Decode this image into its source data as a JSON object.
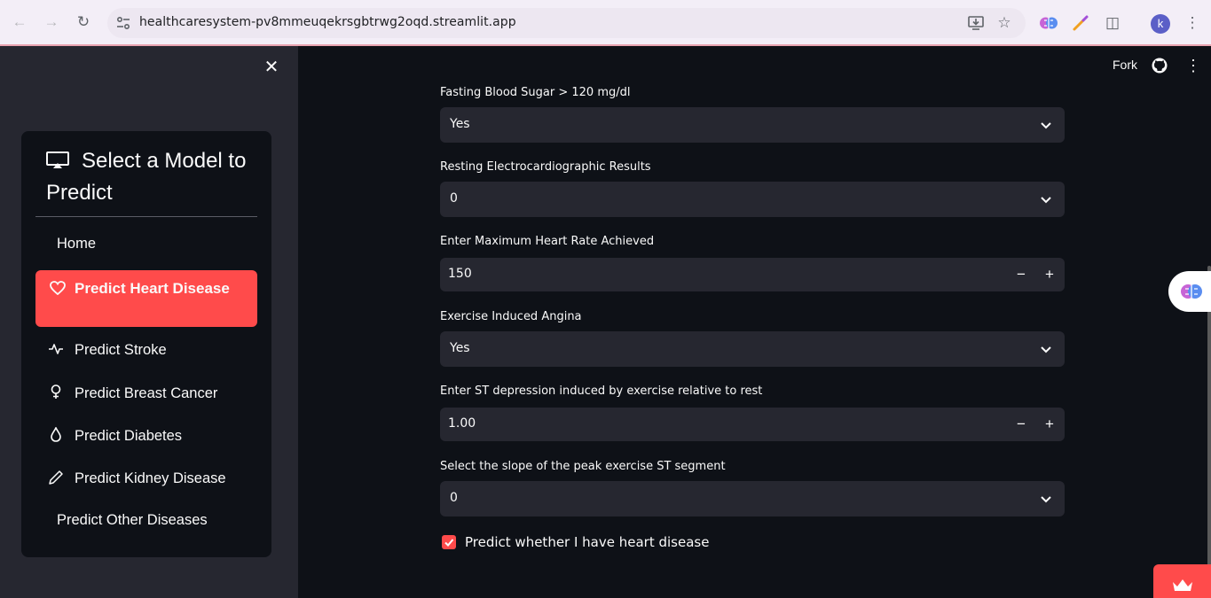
{
  "browser": {
    "url": "healthcaresystem-pv8mmeuqekrsgbtrwg2oqd.streamlit.app",
    "profile_initial": "k"
  },
  "header": {
    "fork_label": "Fork"
  },
  "sidebar": {
    "title": "Select a Model to Predict",
    "items": [
      {
        "label": "Home",
        "icon": "none"
      },
      {
        "label": "Predict Heart Disease",
        "icon": "heart-icon",
        "active": true
      },
      {
        "label": "Predict Stroke",
        "icon": "activity-icon"
      },
      {
        "label": "Predict Breast Cancer",
        "icon": "female-icon"
      },
      {
        "label": "Predict Diabetes",
        "icon": "droplet-icon"
      },
      {
        "label": "Predict Kidney Disease",
        "icon": "pencil-icon"
      },
      {
        "label": "Predict Other Diseases",
        "icon": "none"
      }
    ]
  },
  "form": {
    "fasting_blood_sugar": {
      "label": "Fasting Blood Sugar > 120 mg/dl",
      "value": "Yes"
    },
    "resting_ecg": {
      "label": "Resting Electrocardiographic Results",
      "value": "0"
    },
    "max_heart_rate": {
      "label": "Enter Maximum Heart Rate Achieved",
      "value": "150"
    },
    "exercise_angina": {
      "label": "Exercise Induced Angina",
      "value": "Yes"
    },
    "st_depression": {
      "label": "Enter ST depression induced by exercise relative to rest",
      "value": "1.00"
    },
    "st_slope": {
      "label": "Select the slope of the peak exercise ST segment",
      "value": "0"
    },
    "predict_checkbox": {
      "label": "Predict whether I have heart disease",
      "checked": true
    }
  },
  "colors": {
    "accent": "#ff4b4b",
    "sidebar_bg": "#262730",
    "main_bg": "#0e1117",
    "input_bg": "#262730"
  }
}
